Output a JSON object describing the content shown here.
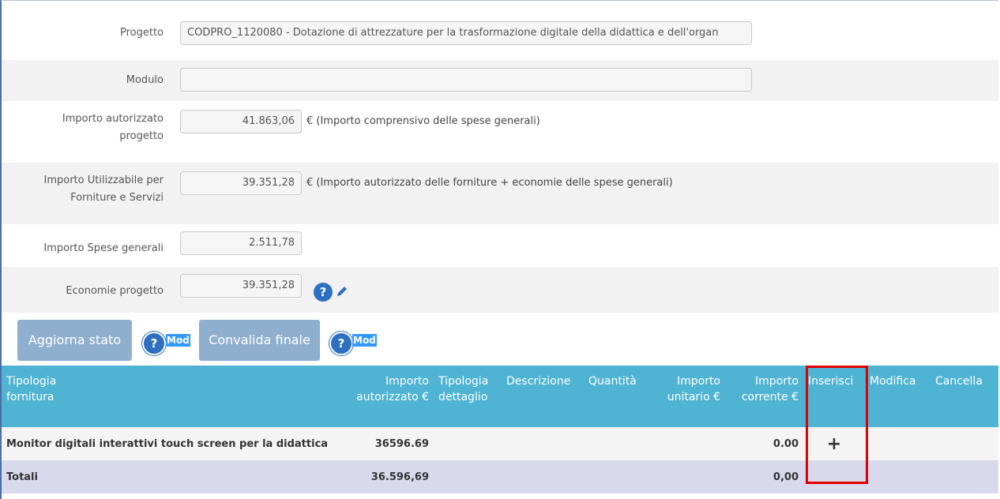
{
  "form": {
    "progetto_label": "Progetto",
    "progetto_value": "CODPRO_1120080 - Dotazione di attrezzature per la trasformazione digitale della didattica e dell'organ",
    "modulo_label": "Modulo",
    "modulo_value": "",
    "importo_autorizzato_label_1": "Importo autorizzato",
    "importo_autorizzato_label_2": "progetto",
    "importo_autorizzato_value": "41.863,06",
    "importo_autorizzato_note": "€ (Importo comprensivo delle spese generali)",
    "importo_utilizzabile_label_1": "Importo Utilizzabile per",
    "importo_utilizzabile_label_2": "Forniture e Servizi",
    "importo_utilizzabile_value": "39.351,28",
    "importo_utilizzabile_note": "€ (Importo autorizzato delle forniture + economie delle spese generali)",
    "spese_generali_label": "Importo Spese generali",
    "spese_generali_value": "2.511,78",
    "economie_label": "Economie progetto",
    "economie_value": "39.351,28"
  },
  "actions": {
    "aggiorna_label": "Aggiorna stato",
    "convalida_label": "Convalida finale",
    "mod_label": "Mod",
    "help_glyph": "?"
  },
  "table": {
    "headers": {
      "tipologia_fornitura_1": "Tipologia",
      "tipologia_fornitura_2": "fornitura",
      "importo_autorizzato_1": "Importo",
      "importo_autorizzato_2": "autorizzato €",
      "tipologia_dettaglio_1": "Tipologia",
      "tipologia_dettaglio_2": "dettaglio",
      "descrizione": "Descrizione",
      "quantita": "Quantità",
      "importo_unitario_1": "Importo",
      "importo_unitario_2": "unitario €",
      "importo_corrente_1": "Importo",
      "importo_corrente_2": "corrente €",
      "inserisci": "Inserisci",
      "modifica": "Modifica",
      "cancella": "Cancella"
    },
    "rows": [
      {
        "tipologia_fornitura": "Monitor digitali interattivi touch screen per la didattica",
        "importo_autorizzato": "36596.69",
        "importo_corrente": "0.00",
        "inserisci_glyph": "+"
      }
    ],
    "totals": {
      "label": "Totali",
      "importo_autorizzato": "36.596,69",
      "importo_corrente": "0,00"
    }
  },
  "colors": {
    "header_bg": "#4fb3d3",
    "button_bg": "#8fafcf",
    "highlight": "#e00000",
    "help_icon": "#2f6fc2"
  }
}
